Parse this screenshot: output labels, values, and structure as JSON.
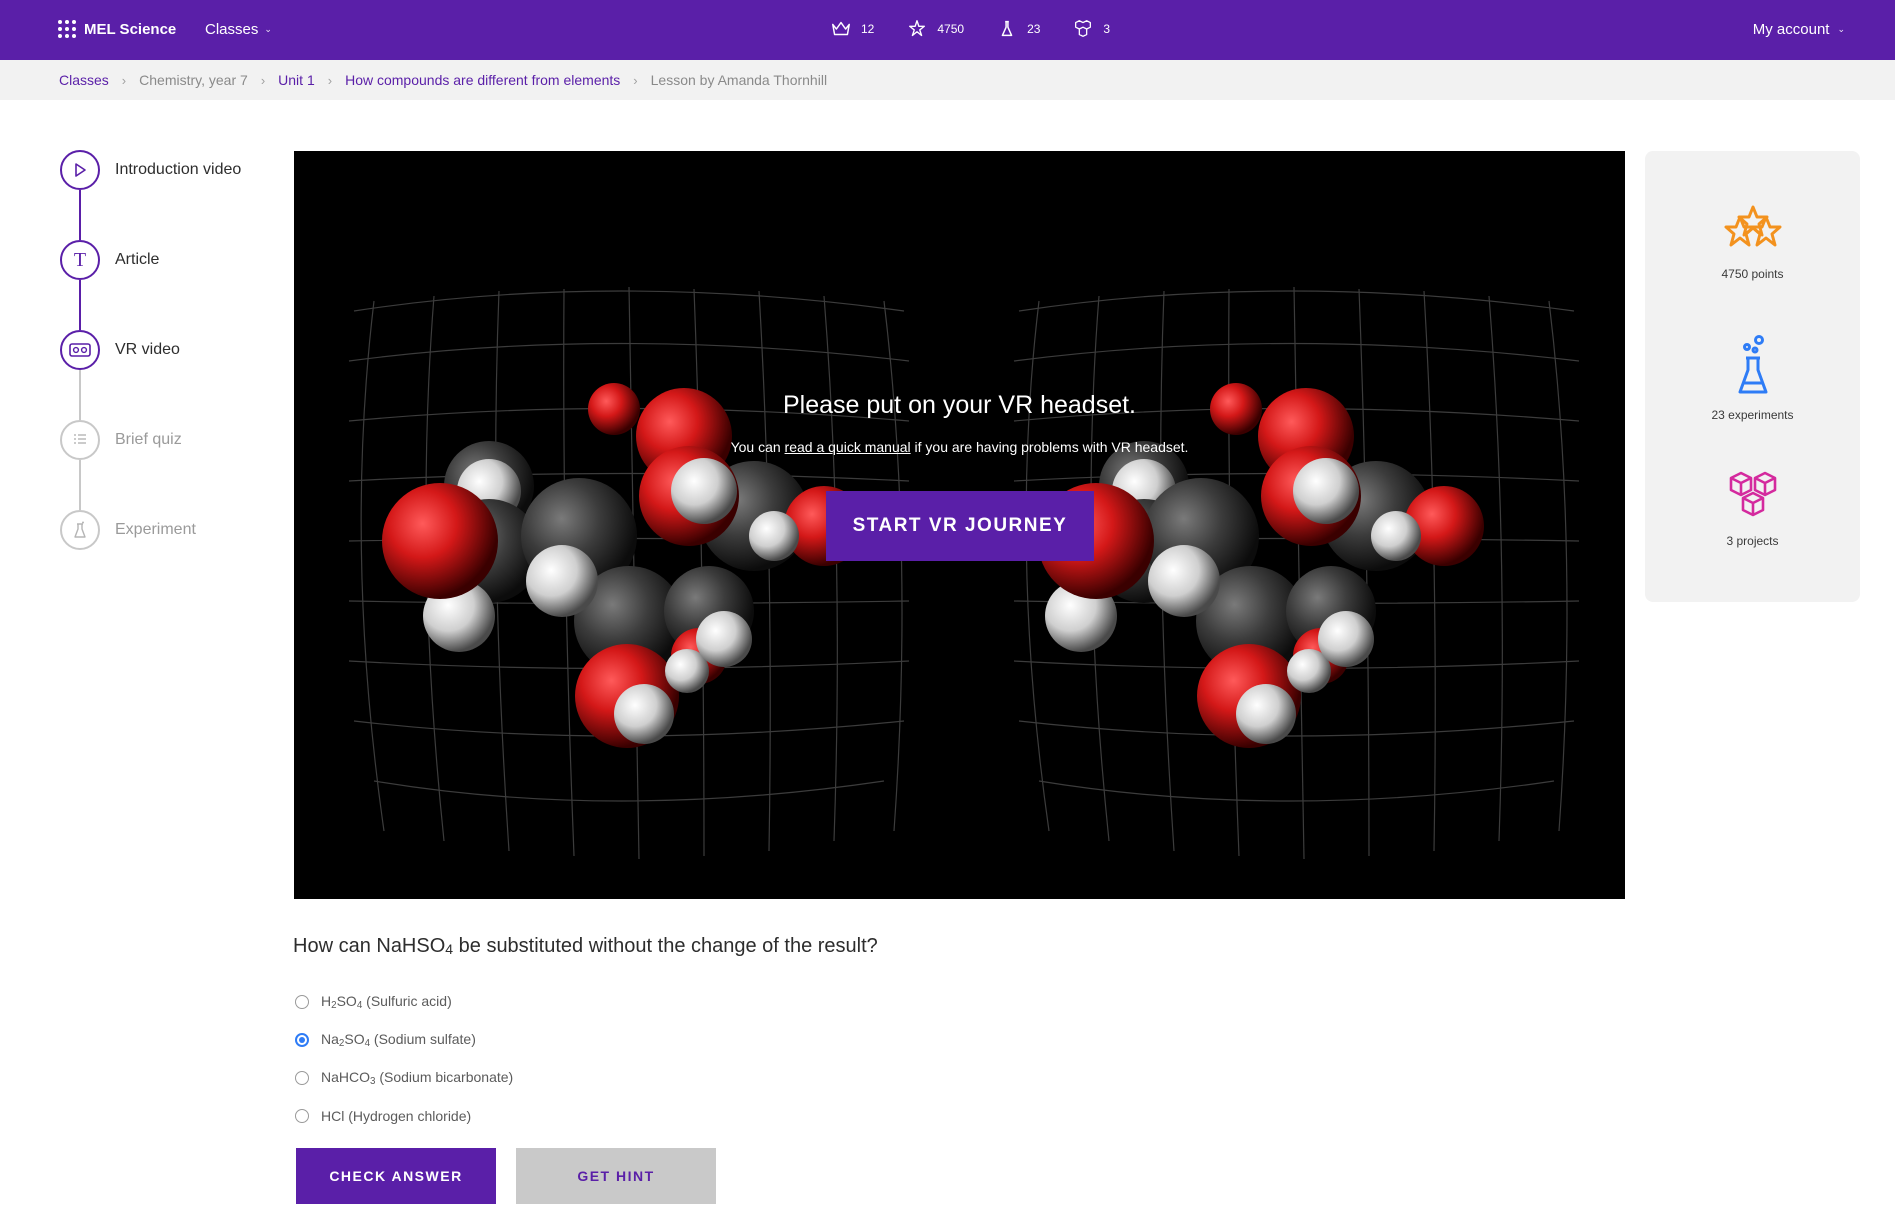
{
  "header": {
    "brand": "MEL Science",
    "classes_menu": "Classes",
    "stats": [
      {
        "icon": "crown-icon",
        "value": "12"
      },
      {
        "icon": "stars-icon",
        "value": "4750"
      },
      {
        "icon": "flask-icon",
        "value": "23"
      },
      {
        "icon": "cubes-icon",
        "value": "3"
      }
    ],
    "account": "My account"
  },
  "breadcrumb": [
    {
      "label": "Classes",
      "link": true
    },
    {
      "label": "Chemistry, year 7",
      "link": false
    },
    {
      "label": "Unit 1",
      "link": true
    },
    {
      "label": "How compounds are different from elements",
      "link": true
    },
    {
      "label": "Lesson by Amanda Thornhill",
      "link": false
    }
  ],
  "steps": [
    {
      "label": "Introduction video",
      "icon": "play-icon",
      "active": true
    },
    {
      "label": "Article",
      "icon": "text-icon",
      "active": true
    },
    {
      "label": "VR video",
      "icon": "vr-headset-icon",
      "active": true
    },
    {
      "label": "Brief quiz",
      "icon": "list-icon",
      "active": false
    },
    {
      "label": "Experiment",
      "icon": "flask-icon",
      "active": false
    }
  ],
  "vr": {
    "title": "Please put on your VR headset.",
    "sub_prefix": "You can ",
    "sub_link": "read a quick manual",
    "sub_suffix": " if you are having problems with VR headset.",
    "button": "START VR JOURNEY"
  },
  "side": {
    "points": "4750 points",
    "experiments": "23 experiments",
    "projects": "3 projects"
  },
  "quiz": {
    "question_prefix": "How can NaHSO",
    "question_sub": "4",
    "question_suffix": " be substituted without the change of the result?",
    "options": [
      {
        "a": "H",
        "a_sub": "2",
        "b": "SO",
        "b_sub": "4",
        "c": " (Sulfuric acid)",
        "selected": false
      },
      {
        "a": "Na",
        "a_sub": "2",
        "b": "SO",
        "b_sub": "4",
        "c": " (Sodium sulfate)",
        "selected": true
      },
      {
        "a": "NaHCO",
        "a_sub": "3",
        "b": "",
        "b_sub": "",
        "c": " (Sodium bicarbonate)",
        "selected": false
      },
      {
        "a": "HCl (Hydrogen chloride)",
        "a_sub": "",
        "b": "",
        "b_sub": "",
        "c": "",
        "selected": false
      }
    ],
    "check_label": "CHECK ANSWER",
    "hint_label": "GET HINT"
  }
}
